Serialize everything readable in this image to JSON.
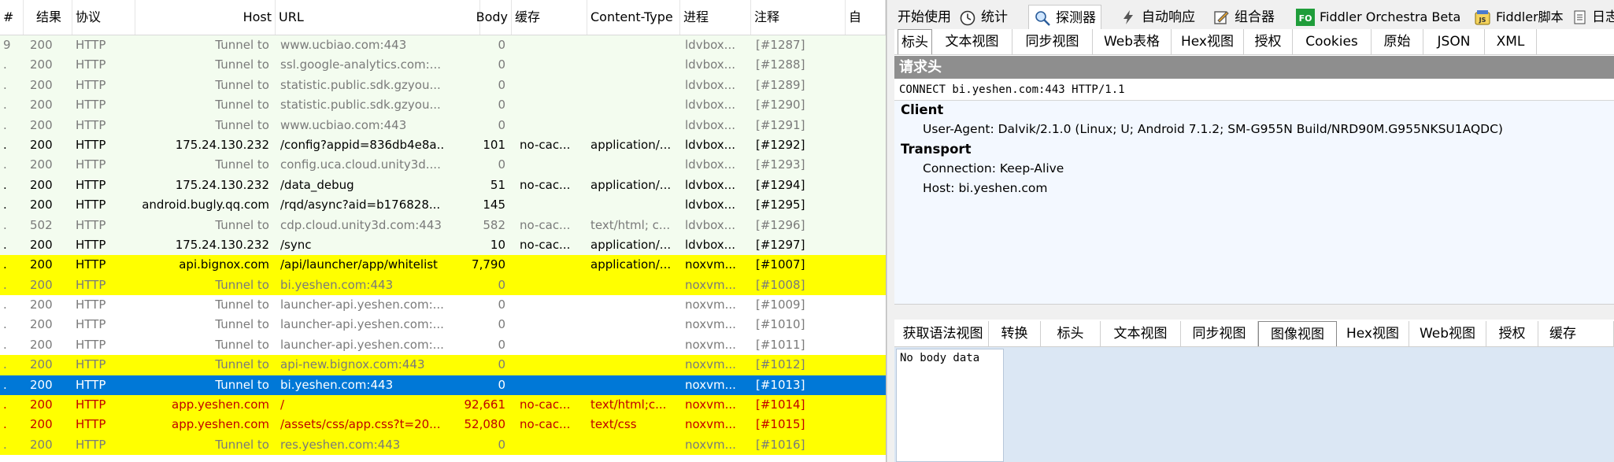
{
  "sessions": {
    "columns": {
      "num": "#",
      "result": "结果",
      "protocol": "协议",
      "host": "Host",
      "url": "URL",
      "body": "Body",
      "cache": "缓存",
      "content_type": "Content-Type",
      "process": "进程",
      "comments": "注释",
      "custom": "自"
    },
    "rows": [
      {
        "num": "9",
        "result": "200",
        "protocol": "HTTP",
        "host": "Tunnel to",
        "url": "www.ucbiao.com:443",
        "body": "0",
        "cache": "",
        "content_type": "",
        "process": "ldvbox...",
        "comment": "[#1287]",
        "style": "tunnel-green"
      },
      {
        "num": ".",
        "result": "200",
        "protocol": "HTTP",
        "host": "Tunnel to",
        "url": "ssl.google-analytics.com:...",
        "body": "0",
        "cache": "",
        "content_type": "",
        "process": "ldvbox...",
        "comment": "[#1288]",
        "style": "tunnel-green"
      },
      {
        "num": ".",
        "result": "200",
        "protocol": "HTTP",
        "host": "Tunnel to",
        "url": "statistic.public.sdk.gzyou...",
        "body": "0",
        "cache": "",
        "content_type": "",
        "process": "ldvbox...",
        "comment": "[#1289]",
        "style": "tunnel-green"
      },
      {
        "num": ".",
        "result": "200",
        "protocol": "HTTP",
        "host": "Tunnel to",
        "url": "statistic.public.sdk.gzyou...",
        "body": "0",
        "cache": "",
        "content_type": "",
        "process": "ldvbox...",
        "comment": "[#1290]",
        "style": "tunnel-green"
      },
      {
        "num": ".",
        "result": "200",
        "protocol": "HTTP",
        "host": "Tunnel to",
        "url": "www.ucbiao.com:443",
        "body": "0",
        "cache": "",
        "content_type": "",
        "process": "ldvbox...",
        "comment": "[#1291]",
        "style": "tunnel-green"
      },
      {
        "num": ".",
        "result": "200",
        "protocol": "HTTP",
        "host": "175.24.130.232",
        "url": "/config?appid=836db4e8a...",
        "body": "101",
        "cache": "no-cac...",
        "content_type": "application/...",
        "process": "ldvbox...",
        "comment": "[#1292]",
        "style": "normal-green"
      },
      {
        "num": ".",
        "result": "200",
        "protocol": "HTTP",
        "host": "Tunnel to",
        "url": "config.uca.cloud.unity3d....",
        "body": "0",
        "cache": "",
        "content_type": "",
        "process": "ldvbox...",
        "comment": "[#1293]",
        "style": "tunnel-green"
      },
      {
        "num": ".",
        "result": "200",
        "protocol": "HTTP",
        "host": "175.24.130.232",
        "url": "/data_debug",
        "body": "51",
        "cache": "no-cac...",
        "content_type": "application/...",
        "process": "ldvbox...",
        "comment": "[#1294]",
        "style": "normal-green"
      },
      {
        "num": ".",
        "result": "200",
        "protocol": "HTTP",
        "host": "android.bugly.qq.com",
        "url": "/rqd/async?aid=b176828...",
        "body": "145",
        "cache": "",
        "content_type": "",
        "process": "ldvbox...",
        "comment": "[#1295]",
        "style": "normal-green"
      },
      {
        "num": ".",
        "result": "502",
        "protocol": "HTTP",
        "host": "Tunnel to",
        "url": "cdp.cloud.unity3d.com:443",
        "body": "582",
        "cache": "no-cac...",
        "content_type": "text/html; c...",
        "process": "ldvbox...",
        "comment": "[#1296]",
        "style": "tunnel-green"
      },
      {
        "num": ".",
        "result": "200",
        "protocol": "HTTP",
        "host": "175.24.130.232",
        "url": "/sync",
        "body": "10",
        "cache": "no-cac...",
        "content_type": "application/...",
        "process": "ldvbox...",
        "comment": "[#1297]",
        "style": "normal-green"
      },
      {
        "num": ".",
        "result": "200",
        "protocol": "HTTP",
        "host": "api.bignox.com",
        "url": "/api/launcher/app/whitelist",
        "body": "7,790",
        "cache": "",
        "content_type": "application/...",
        "process": "noxvm...",
        "comment": "[#1007]",
        "style": "normal-yellow"
      },
      {
        "num": ".",
        "result": "200",
        "protocol": "HTTP",
        "host": "Tunnel to",
        "url": "bi.yeshen.com:443",
        "body": "0",
        "cache": "",
        "content_type": "",
        "process": "noxvm...",
        "comment": "[#1008]",
        "style": "tunnel-yellow"
      },
      {
        "num": ".",
        "result": "200",
        "protocol": "HTTP",
        "host": "Tunnel to",
        "url": "launcher-api.yeshen.com:...",
        "body": "0",
        "cache": "",
        "content_type": "",
        "process": "noxvm...",
        "comment": "[#1009]",
        "style": "tunnel-white"
      },
      {
        "num": ".",
        "result": "200",
        "protocol": "HTTP",
        "host": "Tunnel to",
        "url": "launcher-api.yeshen.com:...",
        "body": "0",
        "cache": "",
        "content_type": "",
        "process": "noxvm...",
        "comment": "[#1010]",
        "style": "tunnel-white"
      },
      {
        "num": ".",
        "result": "200",
        "protocol": "HTTP",
        "host": "Tunnel to",
        "url": "launcher-api.yeshen.com:...",
        "body": "0",
        "cache": "",
        "content_type": "",
        "process": "noxvm...",
        "comment": "[#1011]",
        "style": "tunnel-white"
      },
      {
        "num": ".",
        "result": "200",
        "protocol": "HTTP",
        "host": "Tunnel to",
        "url": "api-new.bignox.com:443",
        "body": "0",
        "cache": "",
        "content_type": "",
        "process": "noxvm...",
        "comment": "[#1012]",
        "style": "tunnel-yellow"
      },
      {
        "num": ".",
        "result": "200",
        "protocol": "HTTP",
        "host": "Tunnel to",
        "url": "bi.yeshen.com:443",
        "body": "0",
        "cache": "",
        "content_type": "",
        "process": "noxvm...",
        "comment": "[#1013]",
        "style": "selected"
      },
      {
        "num": ".",
        "result": "200",
        "protocol": "HTTP",
        "host": "app.yeshen.com",
        "url": "/",
        "body": "92,661",
        "cache": "no-cac...",
        "content_type": "text/html;c...",
        "process": "noxvm...",
        "comment": "[#1014]",
        "style": "red-yellow"
      },
      {
        "num": ".",
        "result": "200",
        "protocol": "HTTP",
        "host": "app.yeshen.com",
        "url": "/assets/css/app.css?t=20...",
        "body": "52,080",
        "cache": "no-cac...",
        "content_type": "text/css",
        "process": "noxvm...",
        "comment": "[#1015]",
        "style": "red-yellow"
      },
      {
        "num": ".",
        "result": "200",
        "protocol": "HTTP",
        "host": "Tunnel to",
        "url": "res.yeshen.com:443",
        "body": "0",
        "cache": "",
        "content_type": "",
        "process": "noxvm...",
        "comment": "[#1016]",
        "style": "tunnel-yellow"
      }
    ]
  },
  "inspector": {
    "top_tabs": [
      {
        "label": "开始使用",
        "icon": ""
      },
      {
        "label": "统计",
        "icon": "timer-icon"
      },
      {
        "label": "探测器",
        "icon": "inspect-icon"
      },
      {
        "label": "自动响应",
        "icon": "lightning-icon"
      },
      {
        "label": "组合器",
        "icon": "compose-icon"
      },
      {
        "label": "Fiddler Orchestra Beta",
        "icon": "fo-icon"
      },
      {
        "label": "Fiddler脚本",
        "icon": "js-icon"
      },
      {
        "label": "日志",
        "icon": "log-icon"
      }
    ],
    "fo_badge": "FO",
    "js_badge": "JS",
    "request_tabs": [
      "标头",
      "文本视图",
      "同步视图",
      "Web表格",
      "Hex视图",
      "授权",
      "Cookies",
      "原始",
      "JSON",
      "XML"
    ],
    "request_header_title": "请求头",
    "request_line": "CONNECT bi.yeshen.com:443 HTTP/1.1",
    "headers": {
      "client_group": "Client",
      "user_agent": "User-Agent: Dalvik/2.1.0 (Linux; U; Android 7.1.2; SM-G955N Build/NRD90M.G955NKSU1AQDC)",
      "transport_group": "Transport",
      "connection": "Connection: Keep-Alive",
      "host": "Host: bi.yeshen.com"
    },
    "response_tabs": [
      "获取语法视图",
      "转换",
      "标头",
      "文本视图",
      "同步视图",
      "图像视图",
      "Hex视图",
      "Web视图",
      "授权",
      "缓存"
    ],
    "response_body_text": "No body data"
  },
  "colors": {
    "green_bg": "#f3fcef",
    "yellow_bg": "#ffff00",
    "white_bg": "#ffffff",
    "selected_bg": "#0078d7",
    "tunnel_text": "#7a7a7a",
    "red_text": "#c00000"
  }
}
